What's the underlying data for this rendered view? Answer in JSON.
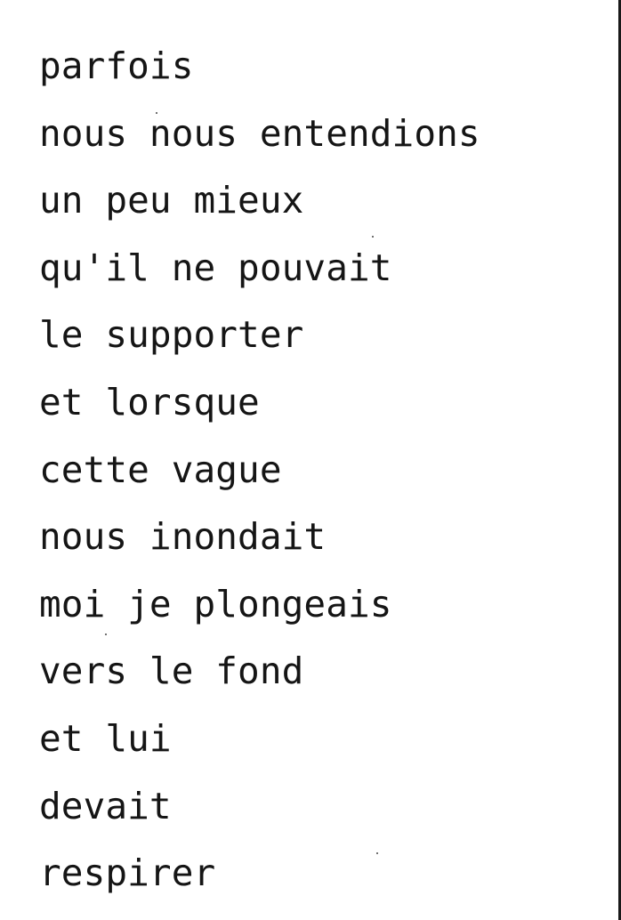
{
  "poem": {
    "lines": [
      "parfois",
      "nous nous entendions",
      "un peu mieux",
      "qu'il ne pouvait",
      "le supporter",
      "et lorsque",
      "cette vague",
      "nous inondait",
      "moi je plongeais",
      "vers le fond",
      "et lui",
      "devait",
      "respirer"
    ]
  }
}
